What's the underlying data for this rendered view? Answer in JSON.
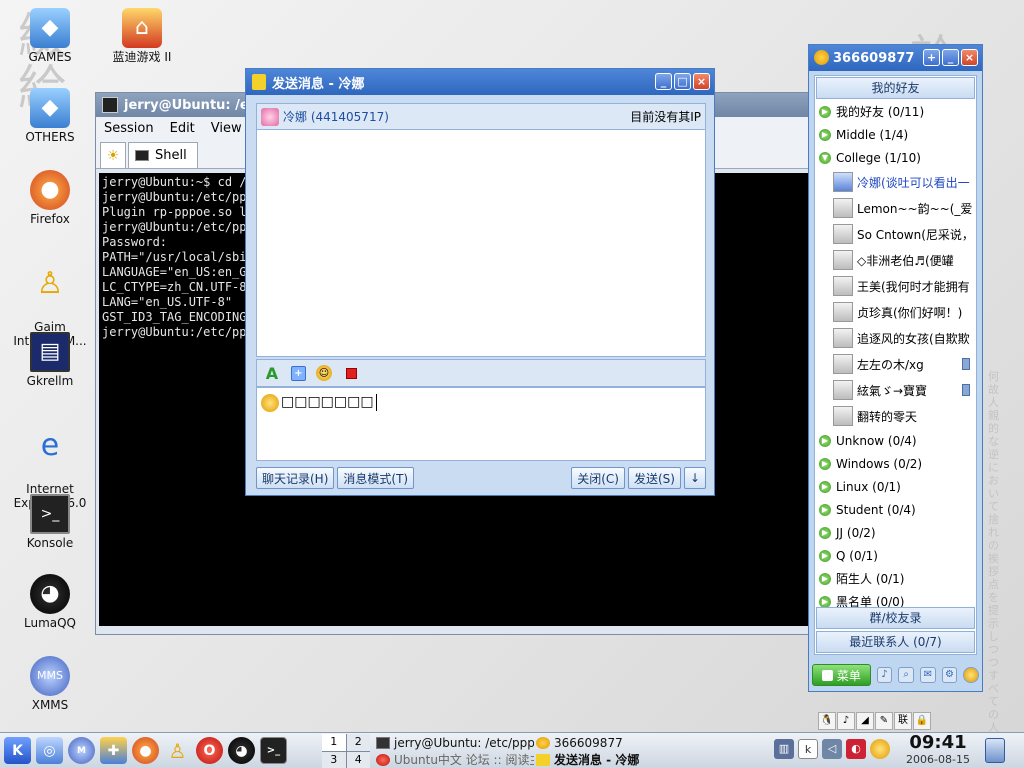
{
  "desktop": {
    "icons": [
      {
        "label": "GAMES"
      },
      {
        "label": "OTHERS"
      },
      {
        "label": "Firefox"
      },
      {
        "label": "Gaim\nInternet M..."
      },
      {
        "label": "Gkrellm"
      },
      {
        "label": "Internet\nExplorer 6.0"
      },
      {
        "label": "Konsole"
      },
      {
        "label": "LumaQQ"
      },
      {
        "label": "XMMS"
      },
      {
        "label": "蓝迪游戏 II"
      }
    ]
  },
  "konsole": {
    "title": "jerry@Ubuntu: /etc",
    "menu": [
      "Session",
      "Edit",
      "View"
    ],
    "tab_label": "Shell",
    "terminal_lines": [
      "jerry@Ubuntu:~$ cd /e",
      "jerry@Ubuntu:/etc/ppp",
      "Plugin rp-pppoe.so lo",
      "jerry@Ubuntu:/etc/ppp",
      "Password:",
      "PATH=\"/usr/local/sbin                                              res\"",
      "LANGUAGE=\"en_US:en_GE",
      "LC_CTYPE=zh_CN.UTF-8",
      "LANG=\"en_US.UTF-8\"",
      "GST_ID3_TAG_ENCODING=",
      "jerry@Ubuntu:/etc/ppp"
    ]
  },
  "chat": {
    "title": "发送消息 - 冷娜",
    "contact": "冷娜 (441405717)",
    "ip_status": "目前没有其IP",
    "input_text": "□□□□□□□",
    "buttons": {
      "history": "聊天记录(H)",
      "mode": "消息模式(T)",
      "close": "关闭(C)",
      "send": "发送(S)",
      "arrow": "↓"
    },
    "window_buttons": {
      "min": "_",
      "max": "□",
      "close": "×"
    }
  },
  "qq": {
    "title": "366609877",
    "window_buttons": {
      "add": "+",
      "min": "_",
      "close": "×"
    },
    "section_top": "我的好友",
    "groups_before": [
      {
        "label": "我的好友 (0/11)"
      },
      {
        "label": "Middle (1/4)"
      },
      {
        "label": "College (1/10)"
      }
    ],
    "friends": [
      {
        "name": "冷娜(谈吐可以看出一",
        "mobile": false
      },
      {
        "name": "Lemon~~韵~~(_爱",
        "mobile": false
      },
      {
        "name": "So Cntown(尼采说，",
        "mobile": false
      },
      {
        "name": "◇非洲老伯♬(便罐",
        "mobile": false
      },
      {
        "name": "王美(我何时才能拥有",
        "mobile": false
      },
      {
        "name": "贞珍真(你们好啊！)",
        "mobile": false
      },
      {
        "name": "追逐风的女孩(自欺欺",
        "mobile": false
      },
      {
        "name": "左左の木/xg",
        "mobile": true
      },
      {
        "name": "絃氣ゞ→寶寶",
        "mobile": true
      },
      {
        "name": "翻转的零天",
        "mobile": false
      }
    ],
    "groups_after": [
      {
        "label": "Unknow (0/4)"
      },
      {
        "label": "Windows (0/2)"
      },
      {
        "label": "Linux (0/1)"
      },
      {
        "label": "Student (0/4)"
      },
      {
        "label": "JJ (0/2)"
      },
      {
        "label": "Q (0/1)"
      },
      {
        "label": "陌生人 (0/1)"
      },
      {
        "label": "黑名单 (0/0)"
      }
    ],
    "section_school": "群/校友录",
    "section_recent": "最近联系人 (0/7)",
    "menu_label": "菜单"
  },
  "tray_strip": [
    "🐧",
    "♪",
    "◢",
    "✎",
    "联",
    "🔒"
  ],
  "taskbar": {
    "pager": [
      "1",
      "2",
      "3",
      "4"
    ],
    "tasks": [
      {
        "label": "jerry@Ubuntu: /etc/ppp/pee"
      },
      {
        "label": "366609877"
      },
      {
        "label": "Ubuntu中文 论坛 :: 阅读主题 -"
      },
      {
        "label": "发送消息 - 冷娜"
      }
    ],
    "clock_time": "09:41",
    "clock_date": "2006-08-15"
  }
}
